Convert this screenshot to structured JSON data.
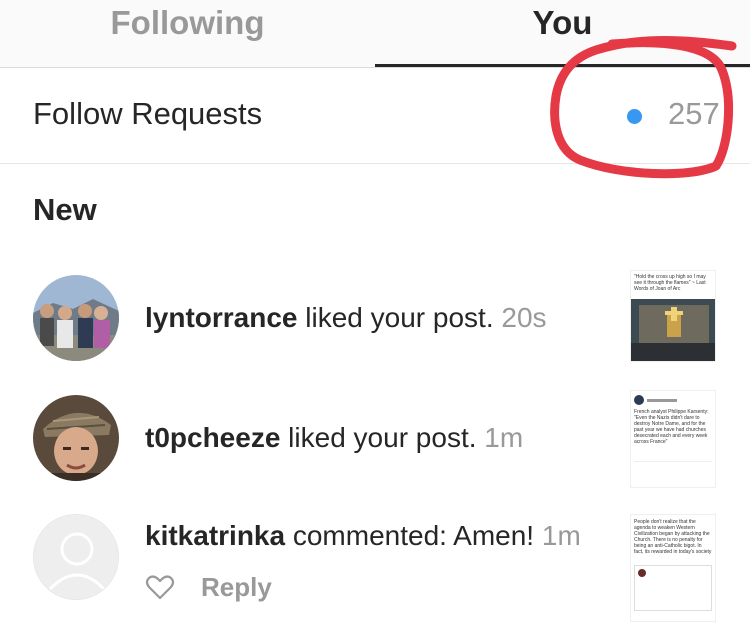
{
  "tabs": {
    "following": "Following",
    "you": "You",
    "active": "you"
  },
  "follow_requests": {
    "label": "Follow Requests",
    "count": "257",
    "dot_color": "#3897f0"
  },
  "annotation": {
    "color": "#e53a46",
    "shape": "hand-drawn-circle"
  },
  "section": {
    "title": "New"
  },
  "activity": [
    {
      "user": "lyntorrance",
      "action": " liked your post. ",
      "time": "20s",
      "avatar_icon": "group-photo-avatar",
      "thumb": {
        "caption": "\"Hold the cross up high so I may see it through the flames\" ~ Last Words of Joan of Arc"
      }
    },
    {
      "user": "t0pcheeze",
      "action": " liked your post. ",
      "time": "1m",
      "avatar_icon": "man-in-cap-avatar",
      "thumb": {
        "caption": "French analyst Philippe Karsenty: \"Even the Nazis didn't dare to destroy Notre Dame, and for the past year we have had churches desecrated each and every week across France\""
      }
    },
    {
      "user": "kitkatrinka",
      "action": " commented: Amen! ",
      "time": "1m",
      "avatar_icon": "default-user-avatar",
      "reply_label": "Reply",
      "thumb": {
        "caption": "People don't realize that the agenda to weaken Western Civilization began by attacking the Church. There is no penalty for being an anti-Catholic bigot. In fact, its rewarded in today's society"
      }
    }
  ],
  "colors": {
    "text": "#262626",
    "secondary": "#999999",
    "divider": "#dbdbdb"
  }
}
